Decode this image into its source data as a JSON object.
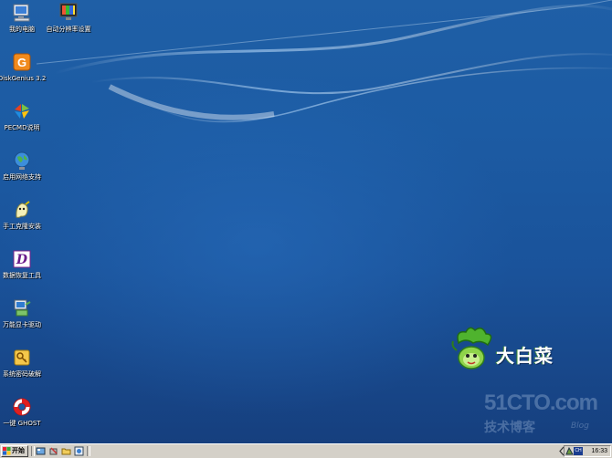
{
  "desktop": {
    "icons": [
      {
        "label": "我的电脑",
        "icon": "my-computer-icon"
      },
      {
        "label": "自动分辨率设置",
        "icon": "resolution-icon"
      },
      {
        "label": "DiskGenius 3.2",
        "icon": "diskgenius-icon"
      },
      {
        "label": "PECMD说明",
        "icon": "pecmd-icon"
      },
      {
        "label": "启用网络支持",
        "icon": "network-globe-icon"
      },
      {
        "label": "手工克隆安装",
        "icon": "ghost-clone-icon"
      },
      {
        "label": "数据恢复工具",
        "icon": "data-recovery-icon"
      },
      {
        "label": "万能显卡驱动",
        "icon": "display-driver-icon"
      },
      {
        "label": "系统密码破解",
        "icon": "password-key-icon"
      },
      {
        "label": "一键 GHOST",
        "icon": "lifebuoy-icon"
      }
    ],
    "logo_text": "大白菜",
    "watermark": {
      "site": "51CTO.com",
      "sub": "技术博客",
      "tag": "Blog"
    }
  },
  "taskbar": {
    "start_label": "开始",
    "language": "CH",
    "clock": "16:33"
  },
  "colors": {
    "desktop_blue": "#1c5ba3",
    "taskbar_gray": "#d4d0c8"
  }
}
